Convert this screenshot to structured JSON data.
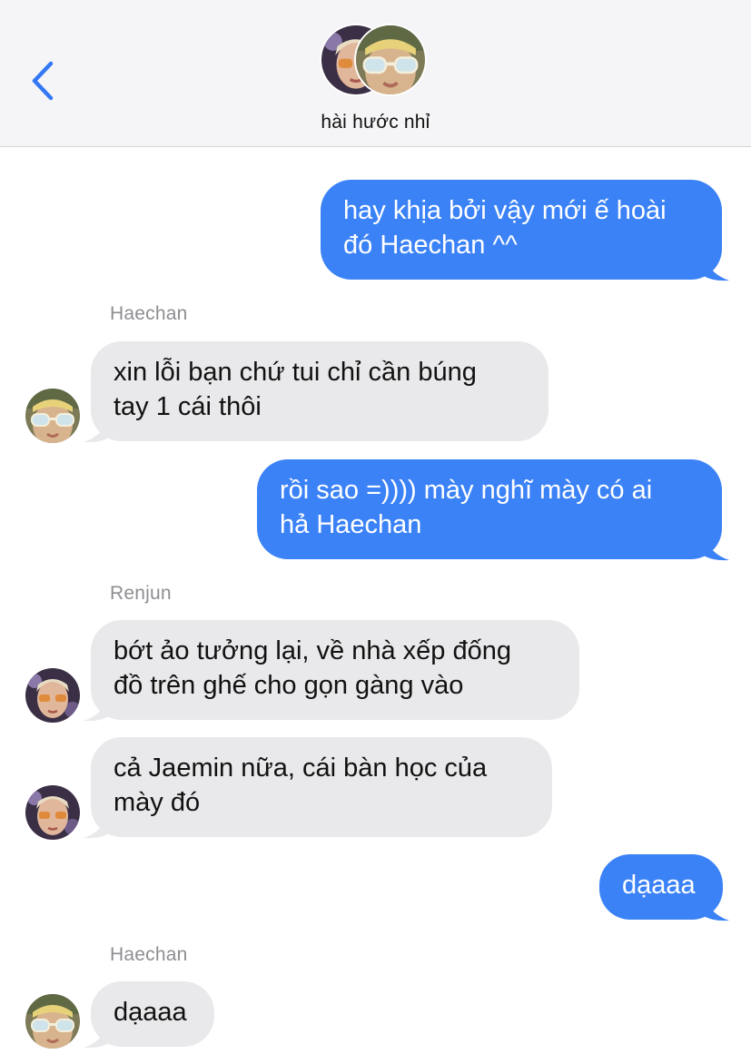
{
  "header": {
    "group_name": "hài hước nhỉ",
    "back_icon": "chevron-left-icon"
  },
  "messages": [
    {
      "direction": "outgoing",
      "lines": [
        "hay khịa bởi vậy mới ế hoài",
        "đó Haechan ^^"
      ]
    },
    {
      "direction": "incoming",
      "sender": "Haechan",
      "lines": [
        "xin lỗi bạn chứ tui chỉ cần búng",
        "tay 1 cái thôi"
      ]
    },
    {
      "direction": "outgoing",
      "lines": [
        "rồi sao =)))) mày nghĩ mày có ai",
        "hả Haechan"
      ]
    },
    {
      "direction": "incoming",
      "sender": "Renjun",
      "lines": [
        "bớt ảo tưởng lại, về nhà xếp đống",
        "đồ trên ghế cho gọn gàng vào"
      ]
    },
    {
      "direction": "incoming",
      "lines": [
        "cả Jaemin nữa, cái bàn học của",
        "mày đó"
      ]
    },
    {
      "direction": "outgoing",
      "lines": [
        "dạaaa"
      ]
    },
    {
      "direction": "incoming",
      "sender": "Haechan",
      "lines": [
        "dạaaa"
      ]
    }
  ],
  "colors": {
    "outgoing_bubble": "#3b82f7",
    "incoming_bubble": "#e9e9eb",
    "accent": "#3478f6",
    "header_bg": "#f5f5f7"
  }
}
